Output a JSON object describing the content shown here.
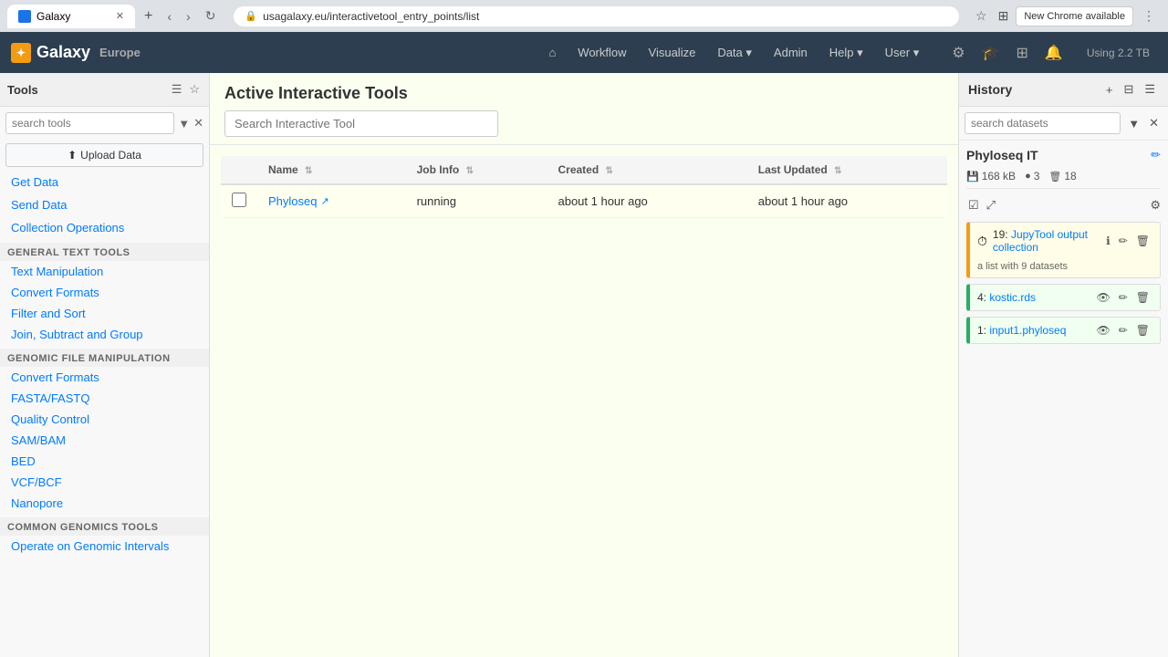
{
  "browser": {
    "tab_title": "Galaxy",
    "address": "usagalaxy.eu/interactivetool_entry_points/list",
    "new_chrome_label": "New Chrome available"
  },
  "navbar": {
    "logo_text": "G",
    "brand": "Galaxy",
    "region": "Europe",
    "nav_items": [
      {
        "label": "⌂",
        "id": "home"
      },
      {
        "label": "Workflow",
        "id": "workflow"
      },
      {
        "label": "Visualize",
        "id": "visualize"
      },
      {
        "label": "Data ▾",
        "id": "data"
      },
      {
        "label": "Admin",
        "id": "admin"
      },
      {
        "label": "Help ▾",
        "id": "help"
      },
      {
        "label": "User ▾",
        "id": "user"
      }
    ],
    "icon_buttons": [
      "⚙",
      "🎓",
      "⊞",
      "🔔"
    ],
    "storage": "Using 2.2 TB"
  },
  "sidebar": {
    "title": "Tools",
    "search_placeholder": "search tools",
    "upload_label": "Upload Data",
    "links": [
      {
        "label": "Get Data",
        "id": "get-data"
      },
      {
        "label": "Send Data",
        "id": "send-data"
      },
      {
        "label": "Collection Operations",
        "id": "collection-ops"
      }
    ],
    "sections": [
      {
        "id": "general-text-tools",
        "label": "GENERAL TEXT TOOLS",
        "items": [
          {
            "label": "Text Manipulation",
            "id": "text-manipulation"
          },
          {
            "label": "Convert Formats",
            "id": "convert-formats-general"
          },
          {
            "label": "Filter and Sort",
            "id": "filter-sort"
          },
          {
            "label": "Join, Subtract and Group",
            "id": "join-subtract-group"
          }
        ]
      },
      {
        "id": "genomic-file-manipulation",
        "label": "GENOMIC FILE MANIPULATION",
        "items": [
          {
            "label": "Convert Formats",
            "id": "convert-formats-genomic"
          },
          {
            "label": "FASTA/FASTQ",
            "id": "fasta-fastq"
          },
          {
            "label": "Quality Control",
            "id": "quality-control"
          },
          {
            "label": "SAM/BAM",
            "id": "sam-bam"
          },
          {
            "label": "BED",
            "id": "bed"
          },
          {
            "label": "VCF/BCF",
            "id": "vcf-bcf"
          },
          {
            "label": "Nanopore",
            "id": "nanopore"
          }
        ]
      },
      {
        "id": "common-genomics-tools",
        "label": "COMMON GENOMICS TOOLS",
        "items": [
          {
            "label": "Operate on Genomic Intervals",
            "id": "operate-genomic-intervals"
          }
        ]
      }
    ]
  },
  "main": {
    "title": "Active Interactive Tools",
    "search_placeholder": "Search Interactive Tool",
    "table": {
      "columns": [
        "Name",
        "Job Info",
        "Created",
        "Last Updated"
      ],
      "rows": [
        {
          "name": "Phyloseq",
          "job_info": "running",
          "created": "about 1 hour ago",
          "last_updated": "about 1 hour ago"
        }
      ]
    }
  },
  "history": {
    "title": "History",
    "search_placeholder": "search datasets",
    "current_history_name": "Phyloseq IT",
    "stats": {
      "size": "168 kB",
      "datasets": "3",
      "items": "18"
    },
    "items": [
      {
        "id": "item-collection",
        "type": "running",
        "number": "19",
        "name": "JupyTool output collection",
        "subtext": "a list with 9 datasets",
        "status_icon": "⏱",
        "color": "running"
      },
      {
        "id": "item-kostic",
        "type": "success",
        "number": "4",
        "name": "kostic.rds",
        "subtext": "",
        "status_icon": "",
        "color": "success-green"
      },
      {
        "id": "item-input1",
        "type": "success",
        "number": "1",
        "name": "input1.phyloseq",
        "subtext": "",
        "status_icon": "",
        "color": "success-green2"
      }
    ]
  }
}
